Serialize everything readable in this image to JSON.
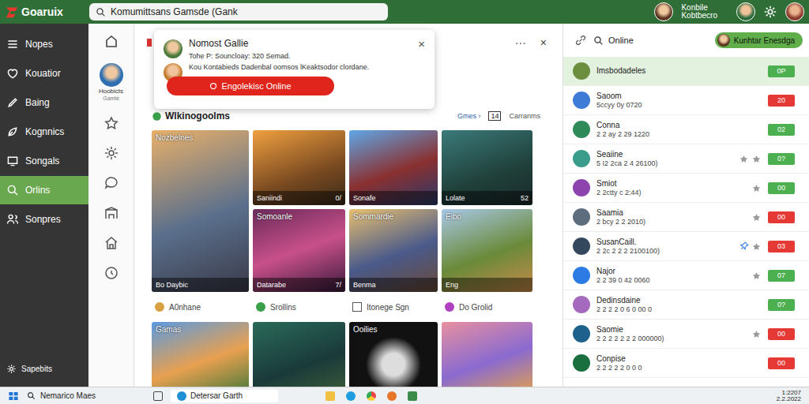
{
  "app": {
    "logo": "Goaruix",
    "search": "Komumittsans Gamsde (Gank",
    "user": {
      "name": "Konbile",
      "sub": "Kobtbecro"
    }
  },
  "sidebar": {
    "items": [
      {
        "label": "Nopes",
        "selected": false
      },
      {
        "label": "Kouatior",
        "selected": false
      },
      {
        "label": "Baing",
        "selected": false
      },
      {
        "label": "Kognnics",
        "selected": false
      },
      {
        "label": "Songals",
        "selected": false
      },
      {
        "label": "Orlins",
        "selected": true
      },
      {
        "label": "Sonpres",
        "selected": false
      }
    ],
    "footer": "Sapebits"
  },
  "rail": {
    "profile": {
      "name": "Hoobicts",
      "sub": "Gamle"
    }
  },
  "main_header": {
    "more": "···",
    "close": "×"
  },
  "notification": {
    "title": "Nomost Gallie",
    "line1": "Tohe P: Souncloay: 320 Semad.",
    "line2": "Kou Kontabieds Dadenbal oomsos lKeaktsodor clordane.",
    "button": "Engolekisc Online",
    "close": "×"
  },
  "section": {
    "title": "Wlkinogoolms",
    "link": "Gmes",
    "arrow": "›",
    "count": "14",
    "extra": "Carranms"
  },
  "games": [
    {
      "title": "Nozbelnes",
      "caption": "Bo Daybic"
    },
    {
      "caption": "Saniindi",
      "count": "0/"
    },
    {
      "caption": "Sonafe"
    },
    {
      "caption": "Lolate",
      "count": "52"
    },
    {
      "title": "Somoanle",
      "caption": "Datarabe",
      "count": "7/"
    },
    {
      "title": "Sommardie",
      "caption": "Benma"
    },
    {
      "title": "Eibo",
      "caption": "Eng"
    }
  ],
  "filters": [
    {
      "label": "A0nhane",
      "kind": "tag"
    },
    {
      "label": "Srollins",
      "kind": "tag"
    },
    {
      "label": "Itonege Sgn",
      "kind": "checkbox",
      "checked": false
    },
    {
      "label": "Do Grolid",
      "kind": "tag"
    }
  ],
  "more_games": [
    {
      "title": "Gamas"
    },
    {},
    {
      "title": "Ooilies"
    },
    {}
  ],
  "online": {
    "search": "Online",
    "button": "Kunhtar Enesdga",
    "rows": [
      {
        "name": "Imsbodadeles",
        "status": "",
        "badge": "0P",
        "color": "#4caf50",
        "stars": 0,
        "pinned": false,
        "selected": true
      },
      {
        "name": "Saoom",
        "status": "5ccyy 0y 0720",
        "badge": "20",
        "color": "#e53935",
        "stars": 0,
        "pinned": false,
        "selected": false
      },
      {
        "name": "Conna",
        "status": "2 2 ay 2 29 1220",
        "badge": "02",
        "color": "#4caf50",
        "stars": 0,
        "pinned": false,
        "selected": false
      },
      {
        "name": "Seaiine",
        "status": "5 I2 2ca 2 4 26100)",
        "badge": "0?",
        "color": "#4caf50",
        "stars": 2,
        "pinned": false,
        "selected": false
      },
      {
        "name": "Smiot",
        "status": "2 2ctty c 2:44)",
        "badge": "00",
        "color": "#4caf50",
        "stars": 1,
        "pinned": false,
        "selected": false
      },
      {
        "name": "Saamia",
        "status": "2 bcy 2 2 2010)",
        "badge": "00",
        "color": "#e53935",
        "stars": 1,
        "pinned": false,
        "selected": false
      },
      {
        "name": "SusanCaill.",
        "status": "2 2c 2 2 2 2100100)",
        "badge": "03",
        "color": "#e53935",
        "stars": 1,
        "pinned": true,
        "selected": false
      },
      {
        "name": "Najor",
        "status": "2 2 39 0 42 0060",
        "badge": "07",
        "color": "#4caf50",
        "stars": 1,
        "pinned": false,
        "selected": false
      },
      {
        "name": "Dedinsdaine",
        "status": "2 2 2 2 0 6 0 00 0",
        "badge": "0?",
        "color": "#4caf50",
        "stars": 0,
        "pinned": false,
        "selected": false
      },
      {
        "name": "Saomie",
        "status": "2 2 2 2 2 2 2 000000)",
        "badge": "00",
        "color": "#e53935",
        "stars": 1,
        "pinned": false,
        "selected": false
      },
      {
        "name": "Conpise",
        "status": "2 2 2 2 2 0 0 0",
        "badge": "00",
        "color": "#e53935",
        "stars": 0,
        "pinned": false,
        "selected": false
      }
    ]
  },
  "taskbar": {
    "search": "Nemarico Maes",
    "app": "Detersar Garth",
    "time": "1:2207",
    "date": "2.2.2022"
  }
}
